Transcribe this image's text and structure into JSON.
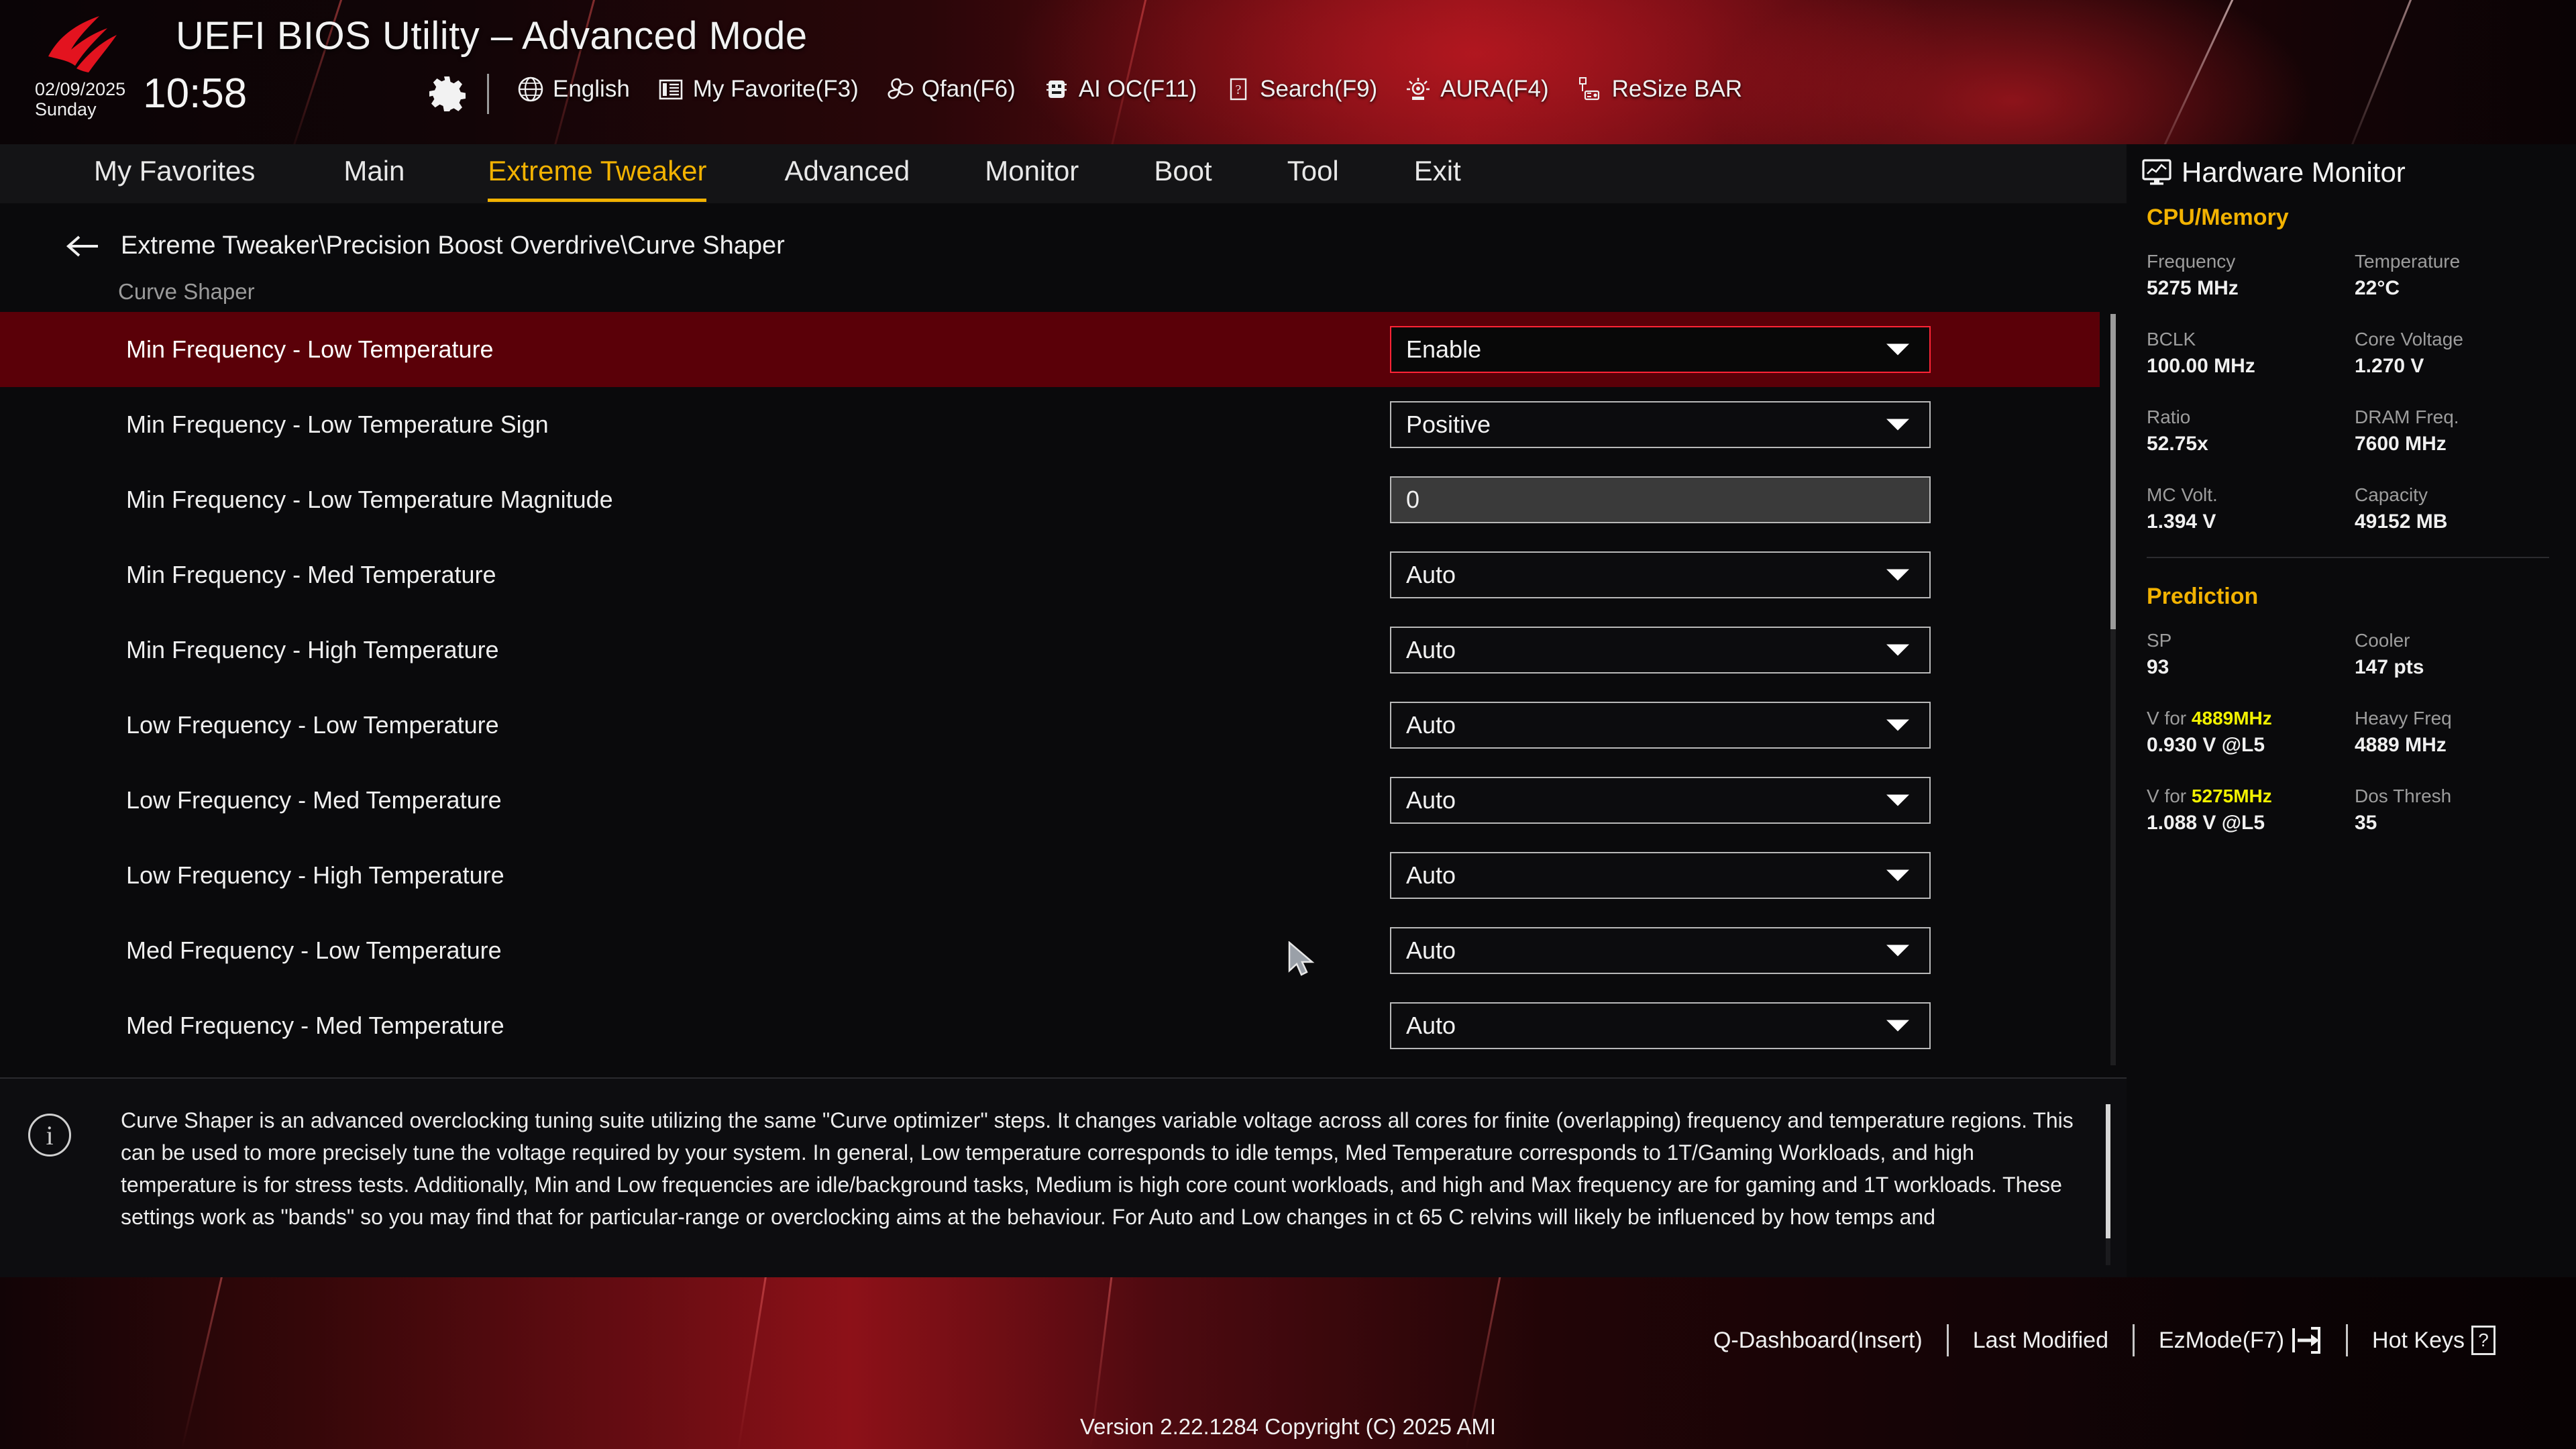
{
  "header": {
    "app_title": "UEFI BIOS Utility – Advanced Mode",
    "logo_icon": "rog-logo-icon",
    "date": "02/09/2025",
    "day": "Sunday",
    "time": "10:58",
    "gear_icon": "gear-icon",
    "toolbar": [
      {
        "icon": "globe-icon",
        "label": "English"
      },
      {
        "icon": "list-icon",
        "label": "My Favorite(F3)"
      },
      {
        "icon": "fan-icon",
        "label": "Qfan(F6)"
      },
      {
        "icon": "ai-chip-icon",
        "label": "AI OC(F11)"
      },
      {
        "icon": "question-box-icon",
        "label": "Search(F9)"
      },
      {
        "icon": "aura-lamp-icon",
        "label": "AURA(F4)"
      },
      {
        "icon": "resize-bar-icon",
        "label": "ReSize BAR"
      }
    ]
  },
  "nav": {
    "tabs": [
      {
        "label": "My Favorites",
        "active": false
      },
      {
        "label": "Main",
        "active": false
      },
      {
        "label": "Extreme Tweaker",
        "active": true
      },
      {
        "label": "Advanced",
        "active": false
      },
      {
        "label": "Monitor",
        "active": false
      },
      {
        "label": "Boot",
        "active": false
      },
      {
        "label": "Tool",
        "active": false
      },
      {
        "label": "Exit",
        "active": false
      }
    ]
  },
  "main": {
    "back_icon": "back-arrow-icon",
    "breadcrumb": "Extreme Tweaker\\Precision Boost Overdrive\\Curve Shaper",
    "section_title": "Curve Shaper",
    "settings": [
      {
        "label": "Min Frequency - Low Temperature",
        "type": "dropdown",
        "value": "Enable",
        "selected": true
      },
      {
        "label": "Min Frequency - Low Temperature Sign",
        "type": "dropdown",
        "value": "Positive",
        "selected": false
      },
      {
        "label": "Min Frequency - Low Temperature Magnitude",
        "type": "text",
        "value": "0",
        "selected": false
      },
      {
        "label": "Min Frequency - Med Temperature",
        "type": "dropdown",
        "value": "Auto",
        "selected": false
      },
      {
        "label": "Min Frequency - High Temperature",
        "type": "dropdown",
        "value": "Auto",
        "selected": false
      },
      {
        "label": "Low Frequency - Low Temperature",
        "type": "dropdown",
        "value": "Auto",
        "selected": false
      },
      {
        "label": "Low Frequency - Med Temperature",
        "type": "dropdown",
        "value": "Auto",
        "selected": false
      },
      {
        "label": "Low Frequency - High Temperature",
        "type": "dropdown",
        "value": "Auto",
        "selected": false
      },
      {
        "label": "Med Frequency - Low Temperature",
        "type": "dropdown",
        "value": "Auto",
        "selected": false
      },
      {
        "label": "Med Frequency - Med Temperature",
        "type": "dropdown",
        "value": "Auto",
        "selected": false
      }
    ]
  },
  "help": {
    "info_icon": "info-icon",
    "text": "Curve Shaper is an advanced overclocking tuning suite utilizing the same \"Curve optimizer\" steps. It changes variable voltage across all cores for finite (overlapping) frequency and temperature regions. This can be used to more precisely tune the voltage required by your system. In general, Low temperature corresponds to idle temps, Med Temperature corresponds to 1T/Gaming Workloads, and high temperature is for stress tests. Additionally, Min and Low frequencies are idle/background tasks, Medium is high core count workloads, and high and Max frequency are for gaming and 1T workloads. These settings work as \"bands\" so you may find that for particular-range or overclocking aims at the behaviour. For Auto and Low changes in ct 65 C relvins will likely be influenced by how temps and"
  },
  "hardware_monitor": {
    "title": "Hardware Monitor",
    "monitor_icon": "hardware-monitor-icon",
    "groups": [
      {
        "name": "CPU/Memory",
        "pairs": [
          [
            {
              "key": "Frequency",
              "value": "5275 MHz"
            },
            {
              "key": "Temperature",
              "value": "22°C"
            }
          ],
          [
            {
              "key": "BCLK",
              "value": "100.00 MHz"
            },
            {
              "key": "Core Voltage",
              "value": "1.270 V"
            }
          ],
          [
            {
              "key": "Ratio",
              "value": "52.75x"
            },
            {
              "key": "DRAM Freq.",
              "value": "7600 MHz"
            }
          ],
          [
            {
              "key": "MC Volt.",
              "value": "1.394 V"
            },
            {
              "key": "Capacity",
              "value": "49152 MB"
            }
          ]
        ]
      },
      {
        "name": "Prediction",
        "pairs": [
          [
            {
              "key": "SP",
              "value": "93"
            },
            {
              "key": "Cooler",
              "value": "147 pts"
            }
          ],
          [
            {
              "key": "V for ",
              "key_highlight": "4889MHz",
              "value": "0.930 V @L5"
            },
            {
              "key": "Heavy Freq",
              "value": "4889 MHz"
            }
          ],
          [
            {
              "key": "V for ",
              "key_highlight": "5275MHz",
              "value": "1.088 V @L5"
            },
            {
              "key": "Dos Thresh",
              "value": "35"
            }
          ]
        ]
      }
    ]
  },
  "footer": {
    "items": [
      {
        "label": "Q-Dashboard(Insert)",
        "icon": ""
      },
      {
        "label": "Last Modified",
        "icon": ""
      },
      {
        "label": "EzMode(F7)",
        "icon": "ez-mode-arrow-icon"
      },
      {
        "label": "Hot Keys",
        "icon": "question-box-icon"
      }
    ],
    "version": "Version 2.22.1284 Copyright (C) 2025 AMI"
  },
  "colors": {
    "accent_yellow": "#f2b201",
    "highlight_yellow": "#f2f200",
    "selection_red": "#5a0008",
    "focus_red": "#ff2436"
  }
}
